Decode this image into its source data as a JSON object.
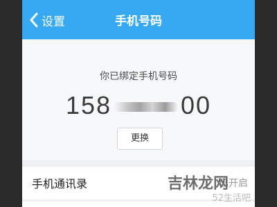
{
  "header": {
    "back_label": "设置",
    "title": "手机号码"
  },
  "card": {
    "bound_text": "你已绑定手机号码",
    "phone_prefix": "158",
    "phone_suffix": "00",
    "change_label": "更换"
  },
  "row": {
    "label": "手机通讯录",
    "value": "已开启"
  },
  "watermark": {
    "logo_text": "吉林龙网",
    "site_text": "52生活吧"
  },
  "colors": {
    "header_bg": "#36a9f2",
    "card_bg": "#f7f8fa",
    "page_bg": "#eef0f3"
  }
}
